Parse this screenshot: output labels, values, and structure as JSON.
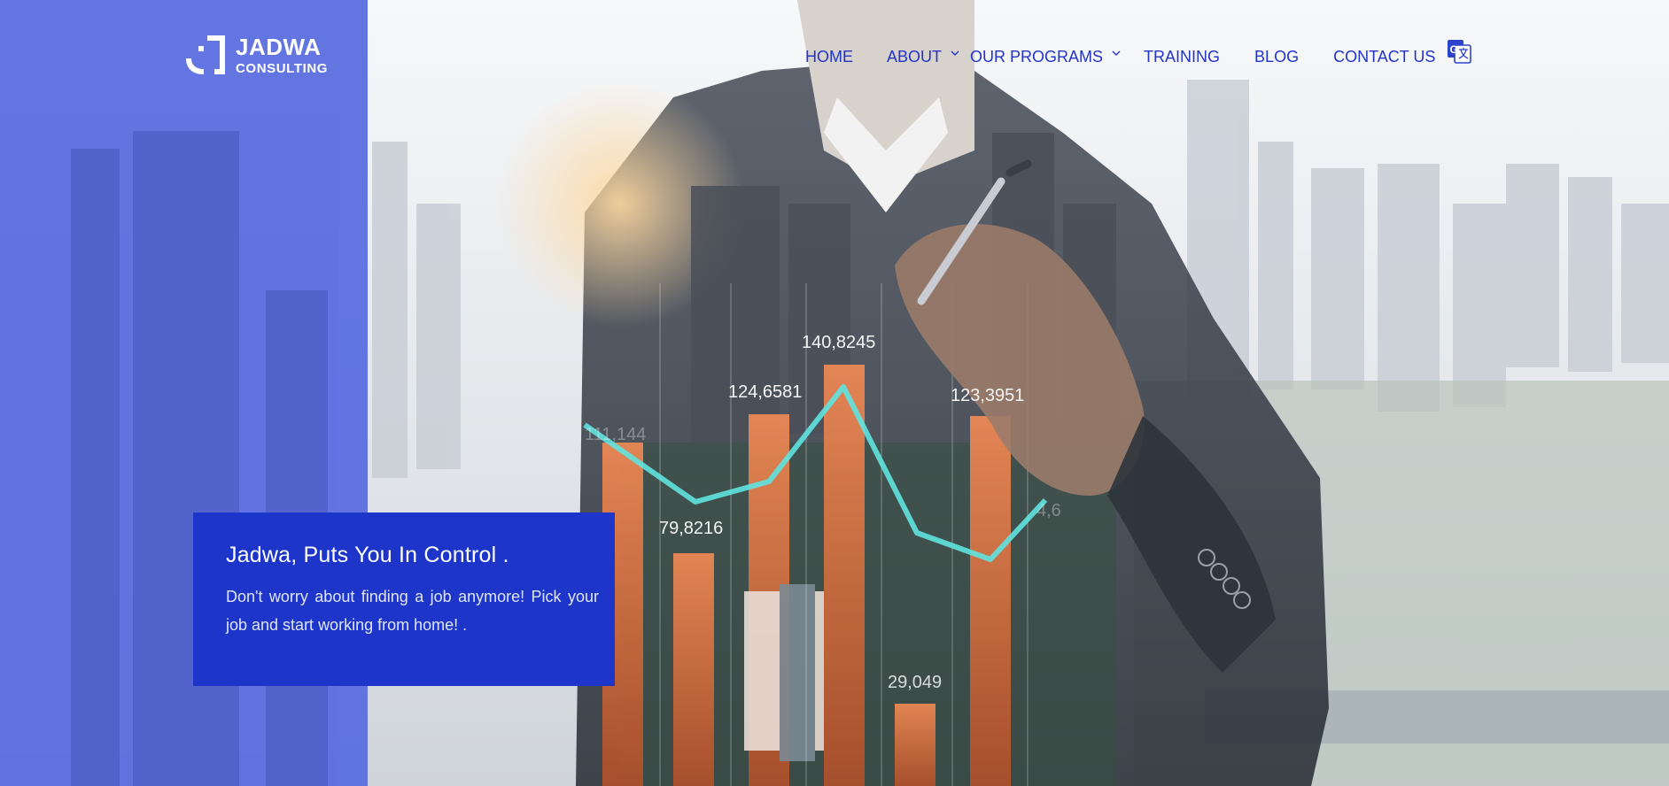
{
  "brand": {
    "name": "JADWA",
    "subtitle": "CONSULTING",
    "logo_icon": "jadwa-logo-icon"
  },
  "nav": {
    "items": [
      {
        "label": "HOME",
        "active": true
      },
      {
        "label": "ABOUT",
        "has_dropdown": true
      },
      {
        "label": "OUR PROGRAMS",
        "has_dropdown": true
      },
      {
        "label": "TRAINING"
      },
      {
        "label": "BLOG"
      },
      {
        "label": "CONTACT US"
      }
    ],
    "translate_icon": "google-translate-icon",
    "color": "#2334c8"
  },
  "hero": {
    "title": "Jadwa, Puts You In Control .",
    "description": "Don't worry about finding a job anymore! Pick your job and start working from home! .",
    "card_color": "#1d36c9"
  },
  "background_chart": {
    "labels": [
      "111,144",
      "79,8216",
      "124,6581",
      "140,8245",
      "29,049",
      "123,3951",
      "4,6"
    ]
  },
  "colors": {
    "left_panel": "#5c6fe0",
    "accent_line": "#5fe3e0",
    "bars": "#e07a4a"
  }
}
